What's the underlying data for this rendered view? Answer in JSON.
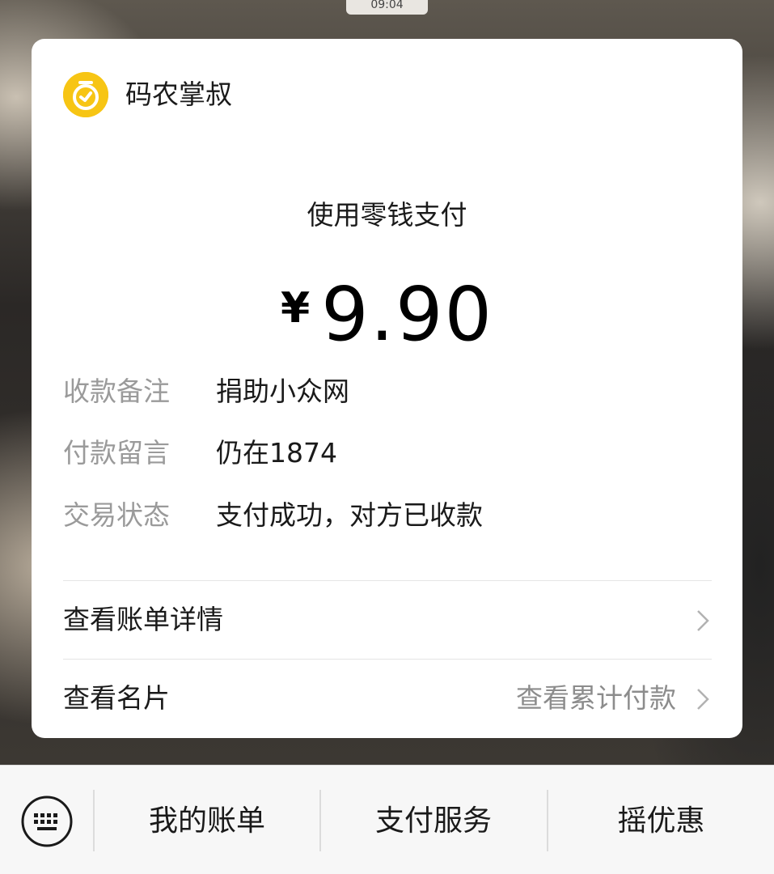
{
  "status_time": "09:04",
  "merchant": {
    "name": "码农掌叔",
    "logo_icon": "merchant-clock-logo-icon",
    "logo_color": "#f7c514"
  },
  "payment": {
    "method": "使用零钱支付",
    "currency": "¥",
    "amount": "9.90"
  },
  "details": [
    {
      "key": "收款备注",
      "value": "捐助小众网"
    },
    {
      "key": "付款留言",
      "value": "仍在1874"
    },
    {
      "key": "交易状态",
      "value": "支付成功，对方已收款"
    }
  ],
  "links": {
    "bill_details": "查看账单详情",
    "view_card": "查看名片",
    "cumulative": "查看累计付款"
  },
  "bottom_bar": {
    "keyboard_icon": "keyboard-icon",
    "tabs": [
      "我的账单",
      "支付服务",
      "摇优惠"
    ]
  }
}
